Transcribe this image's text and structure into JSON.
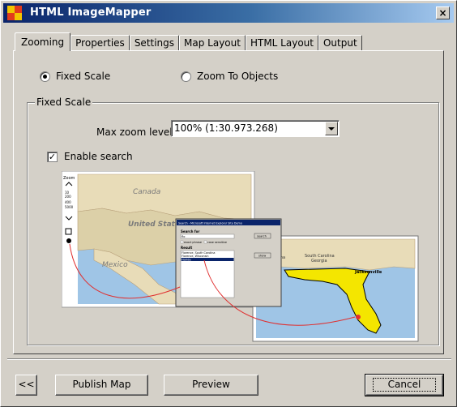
{
  "window": {
    "title": "HTML ImageMapper",
    "close_glyph": "×"
  },
  "tabs": [
    {
      "label": "Zooming",
      "active": true
    },
    {
      "label": "Properties",
      "active": false
    },
    {
      "label": "Settings",
      "active": false
    },
    {
      "label": "Map Layout",
      "active": false
    },
    {
      "label": "HTML Layout",
      "active": false
    },
    {
      "label": "Output",
      "active": false
    }
  ],
  "zoom_mode": {
    "fixed_scale_label": "Fixed Scale",
    "zoom_to_objects_label": "Zoom To Objects",
    "selected": "fixed_scale"
  },
  "fixed_scale_group": {
    "legend": "Fixed Scale",
    "max_zoom_label": "Max zoom level",
    "max_zoom_value": "100%  (1:30.973.268)",
    "enable_search_label": "Enable search",
    "enable_search_checked": true
  },
  "illustration": {
    "map1_labels": [
      "Canada",
      "United States",
      "Mexico"
    ],
    "zoom_label": "Zoom",
    "zoom_ticks": [
      "10",
      "200",
      "400",
      "5000"
    ],
    "search_window_title": "Search - Microsoft Internet Explorer Site Demo",
    "search_for_label": "Search for",
    "search_input_value": "flo",
    "search_button": "search",
    "search_options": [
      "exact phrase",
      "case sensitive"
    ],
    "result_label": "Result",
    "results": [
      "Florence, South Carolina",
      "Florence, Wisconsin",
      "Florida"
    ],
    "show_button": "show",
    "map2_labels": [
      "South Carolina",
      "Alabama",
      "Georgia",
      "Jacksonville"
    ]
  },
  "buttons": {
    "back": "<<",
    "publish": "Publish Map",
    "preview": "Preview",
    "cancel": "Cancel"
  },
  "colors": {
    "title_bar_start": "#0a246a",
    "title_bar_end": "#a6caf0",
    "dialog_bg": "#d4d0c8",
    "florida_fill": "#f4e600",
    "arrow": "#e03030"
  }
}
